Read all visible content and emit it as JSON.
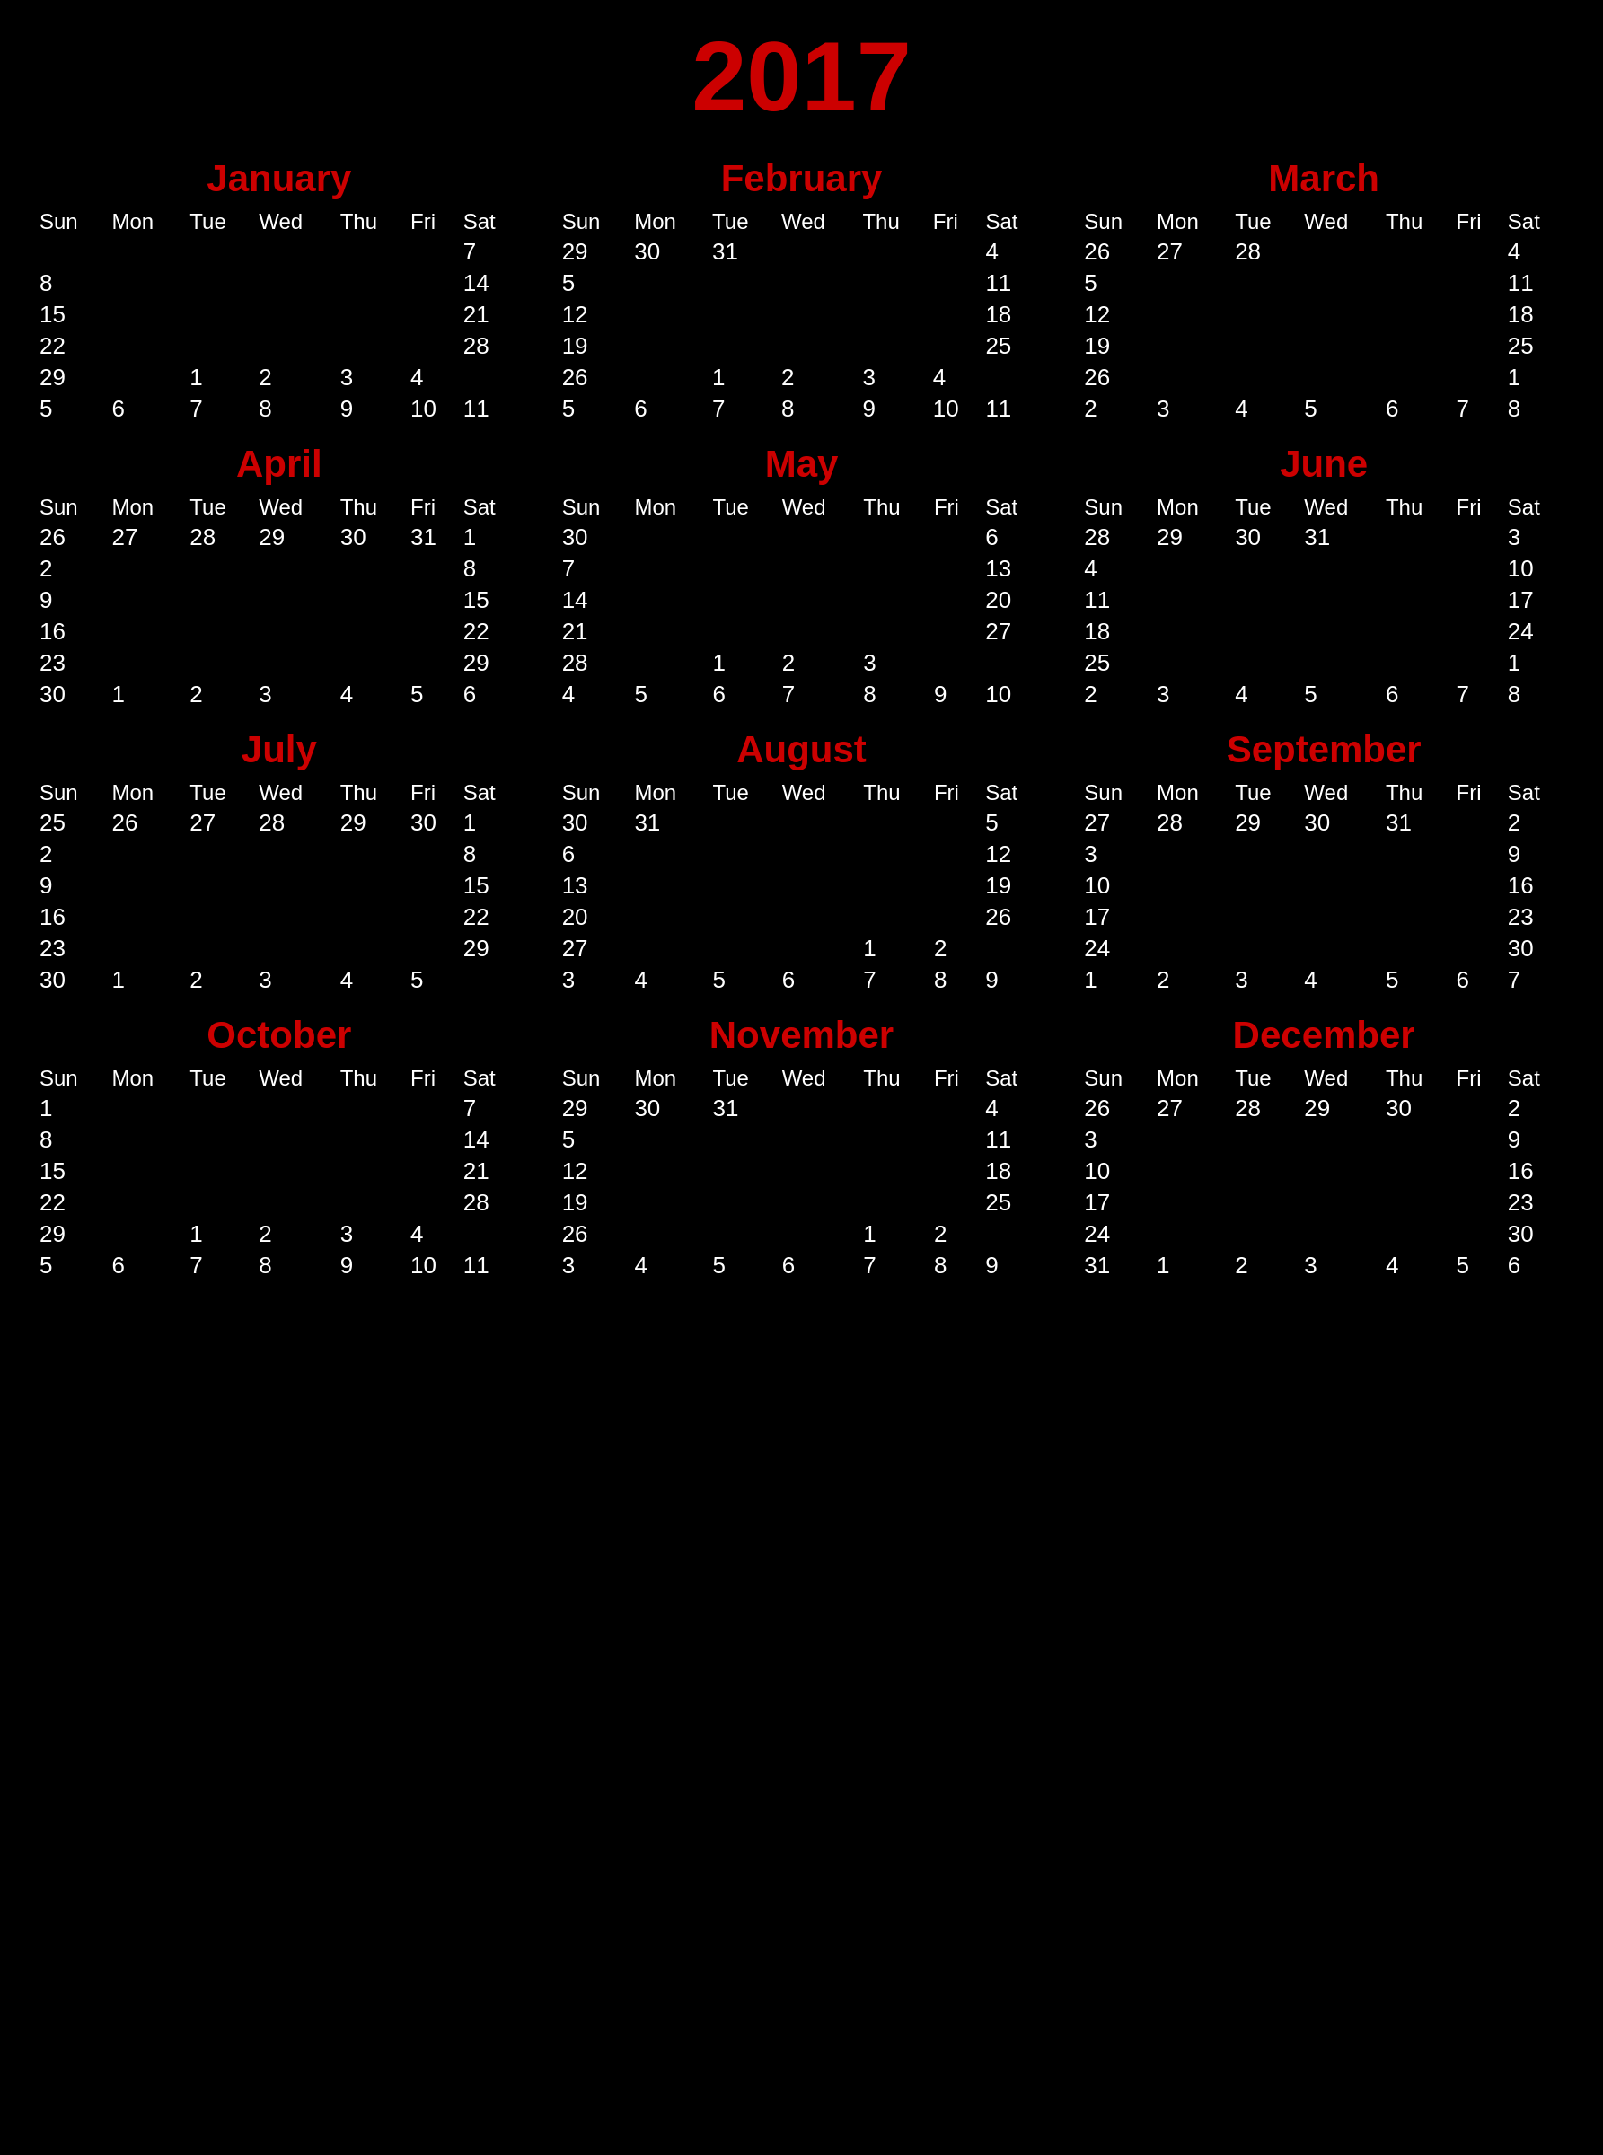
{
  "year": "2017",
  "months": [
    {
      "name": "January",
      "days": [
        [
          "",
          "",
          "",
          "",
          "",
          "",
          "7"
        ],
        [
          "8",
          "",
          "",
          "",
          "",
          "",
          "14"
        ],
        [
          "15",
          "",
          "",
          "",
          "",
          "",
          "21"
        ],
        [
          "22",
          "",
          "",
          "",
          "",
          "",
          "28"
        ],
        [
          "29",
          "",
          "1",
          "2",
          "3",
          "4",
          ""
        ],
        [
          "5",
          "6",
          "7",
          "8",
          "9",
          "10",
          "11"
        ]
      ]
    },
    {
      "name": "February",
      "days": [
        [
          "29",
          "30",
          "31",
          "",
          "",
          "",
          "4"
        ],
        [
          "5",
          "",
          "",
          "",
          "",
          "",
          "11"
        ],
        [
          "12",
          "",
          "",
          "",
          "",
          "",
          "18"
        ],
        [
          "19",
          "",
          "",
          "",
          "",
          "",
          "25"
        ],
        [
          "26",
          "",
          "1",
          "2",
          "3",
          "4",
          ""
        ],
        [
          "5",
          "6",
          "7",
          "8",
          "9",
          "10",
          "11"
        ]
      ]
    },
    {
      "name": "March",
      "days": [
        [
          "26",
          "27",
          "28",
          "",
          "",
          "",
          "4"
        ],
        [
          "5",
          "",
          "",
          "",
          "",
          "",
          "11"
        ],
        [
          "12",
          "",
          "",
          "",
          "",
          "",
          "18"
        ],
        [
          "19",
          "",
          "",
          "",
          "",
          "",
          "25"
        ],
        [
          "26",
          "",
          "",
          "",
          "",
          "",
          "1"
        ],
        [
          "2",
          "3",
          "4",
          "5",
          "6",
          "7",
          "8"
        ]
      ]
    },
    {
      "name": "April",
      "days": [
        [
          "26",
          "27",
          "28",
          "29",
          "30",
          "31",
          "1"
        ],
        [
          "2",
          "",
          "",
          "",
          "",
          "",
          "8"
        ],
        [
          "9",
          "",
          "",
          "",
          "",
          "",
          "15"
        ],
        [
          "16",
          "",
          "",
          "",
          "",
          "",
          "22"
        ],
        [
          "23",
          "",
          "",
          "",
          "",
          "",
          "29"
        ],
        [
          "30",
          "1",
          "2",
          "3",
          "4",
          "5",
          "6"
        ]
      ]
    },
    {
      "name": "May",
      "days": [
        [
          "30",
          "",
          "",
          "",
          "",
          "",
          "6"
        ],
        [
          "7",
          "",
          "",
          "",
          "",
          "",
          "13"
        ],
        [
          "14",
          "",
          "",
          "",
          "",
          "",
          "20"
        ],
        [
          "21",
          "",
          "",
          "",
          "",
          "",
          "27"
        ],
        [
          "28",
          "",
          "1",
          "2",
          "3",
          "",
          ""
        ],
        [
          "4",
          "5",
          "6",
          "7",
          "8",
          "9",
          "10"
        ]
      ]
    },
    {
      "name": "June",
      "days": [
        [
          "28",
          "29",
          "30",
          "31",
          "",
          "",
          "3"
        ],
        [
          "4",
          "",
          "",
          "",
          "",
          "",
          "10"
        ],
        [
          "11",
          "",
          "",
          "",
          "",
          "",
          "17"
        ],
        [
          "18",
          "",
          "",
          "",
          "",
          "",
          "24"
        ],
        [
          "25",
          "",
          "",
          "",
          "",
          "",
          "1"
        ],
        [
          "2",
          "3",
          "4",
          "5",
          "6",
          "7",
          "8"
        ]
      ]
    },
    {
      "name": "July",
      "days": [
        [
          "25",
          "26",
          "27",
          "28",
          "29",
          "30",
          "1"
        ],
        [
          "2",
          "",
          "",
          "",
          "",
          "",
          "8"
        ],
        [
          "9",
          "",
          "",
          "",
          "",
          "",
          "15"
        ],
        [
          "16",
          "",
          "",
          "",
          "",
          "",
          "22"
        ],
        [
          "23",
          "",
          "",
          "",
          "",
          "",
          "29"
        ],
        [
          "30",
          "1",
          "2",
          "3",
          "4",
          "5",
          ""
        ]
      ]
    },
    {
      "name": "August",
      "days": [
        [
          "30",
          "31",
          "",
          "",
          "",
          "",
          "5"
        ],
        [
          "6",
          "",
          "",
          "",
          "",
          "",
          "12"
        ],
        [
          "13",
          "",
          "",
          "",
          "",
          "",
          "19"
        ],
        [
          "20",
          "",
          "",
          "",
          "",
          "",
          "26"
        ],
        [
          "27",
          "",
          "",
          "",
          "1",
          "2",
          ""
        ],
        [
          "3",
          "4",
          "5",
          "6",
          "7",
          "8",
          "9"
        ]
      ]
    },
    {
      "name": "September",
      "days": [
        [
          "27",
          "28",
          "29",
          "30",
          "31",
          "",
          "2"
        ],
        [
          "3",
          "",
          "",
          "",
          "",
          "",
          "9"
        ],
        [
          "10",
          "",
          "",
          "",
          "",
          "",
          "16"
        ],
        [
          "17",
          "",
          "",
          "",
          "",
          "",
          "23"
        ],
        [
          "24",
          "",
          "",
          "",
          "",
          "",
          "30"
        ],
        [
          "1",
          "2",
          "3",
          "4",
          "5",
          "6",
          "7"
        ]
      ]
    },
    {
      "name": "October",
      "days": [
        [
          "1",
          "",
          "",
          "",
          "",
          "",
          "7"
        ],
        [
          "8",
          "",
          "",
          "",
          "",
          "",
          "14"
        ],
        [
          "15",
          "",
          "",
          "",
          "",
          "",
          "21"
        ],
        [
          "22",
          "",
          "",
          "",
          "",
          "",
          "28"
        ],
        [
          "29",
          "",
          "1",
          "2",
          "3",
          "4",
          ""
        ],
        [
          "5",
          "6",
          "7",
          "8",
          "9",
          "10",
          "11"
        ]
      ]
    },
    {
      "name": "November",
      "days": [
        [
          "29",
          "30",
          "31",
          "",
          "",
          "",
          "4"
        ],
        [
          "5",
          "",
          "",
          "",
          "",
          "",
          "11"
        ],
        [
          "12",
          "",
          "",
          "",
          "",
          "",
          "18"
        ],
        [
          "19",
          "",
          "",
          "",
          "",
          "",
          "25"
        ],
        [
          "26",
          "",
          "",
          "",
          "1",
          "2",
          ""
        ],
        [
          "3",
          "4",
          "5",
          "6",
          "7",
          "8",
          "9"
        ]
      ]
    },
    {
      "name": "December",
      "days": [
        [
          "26",
          "27",
          "28",
          "29",
          "30",
          "",
          "2"
        ],
        [
          "3",
          "",
          "",
          "",
          "",
          "",
          "9"
        ],
        [
          "10",
          "",
          "",
          "",
          "",
          "",
          "16"
        ],
        [
          "17",
          "",
          "",
          "",
          "",
          "",
          "23"
        ],
        [
          "24",
          "",
          "",
          "",
          "",
          "",
          "30"
        ],
        [
          "31",
          "1",
          "2",
          "3",
          "4",
          "5",
          "6"
        ]
      ]
    }
  ],
  "weekdays": [
    "Sun",
    "Mon",
    "Tue",
    "Wed",
    "Thu",
    "Fri",
    "Sat"
  ]
}
